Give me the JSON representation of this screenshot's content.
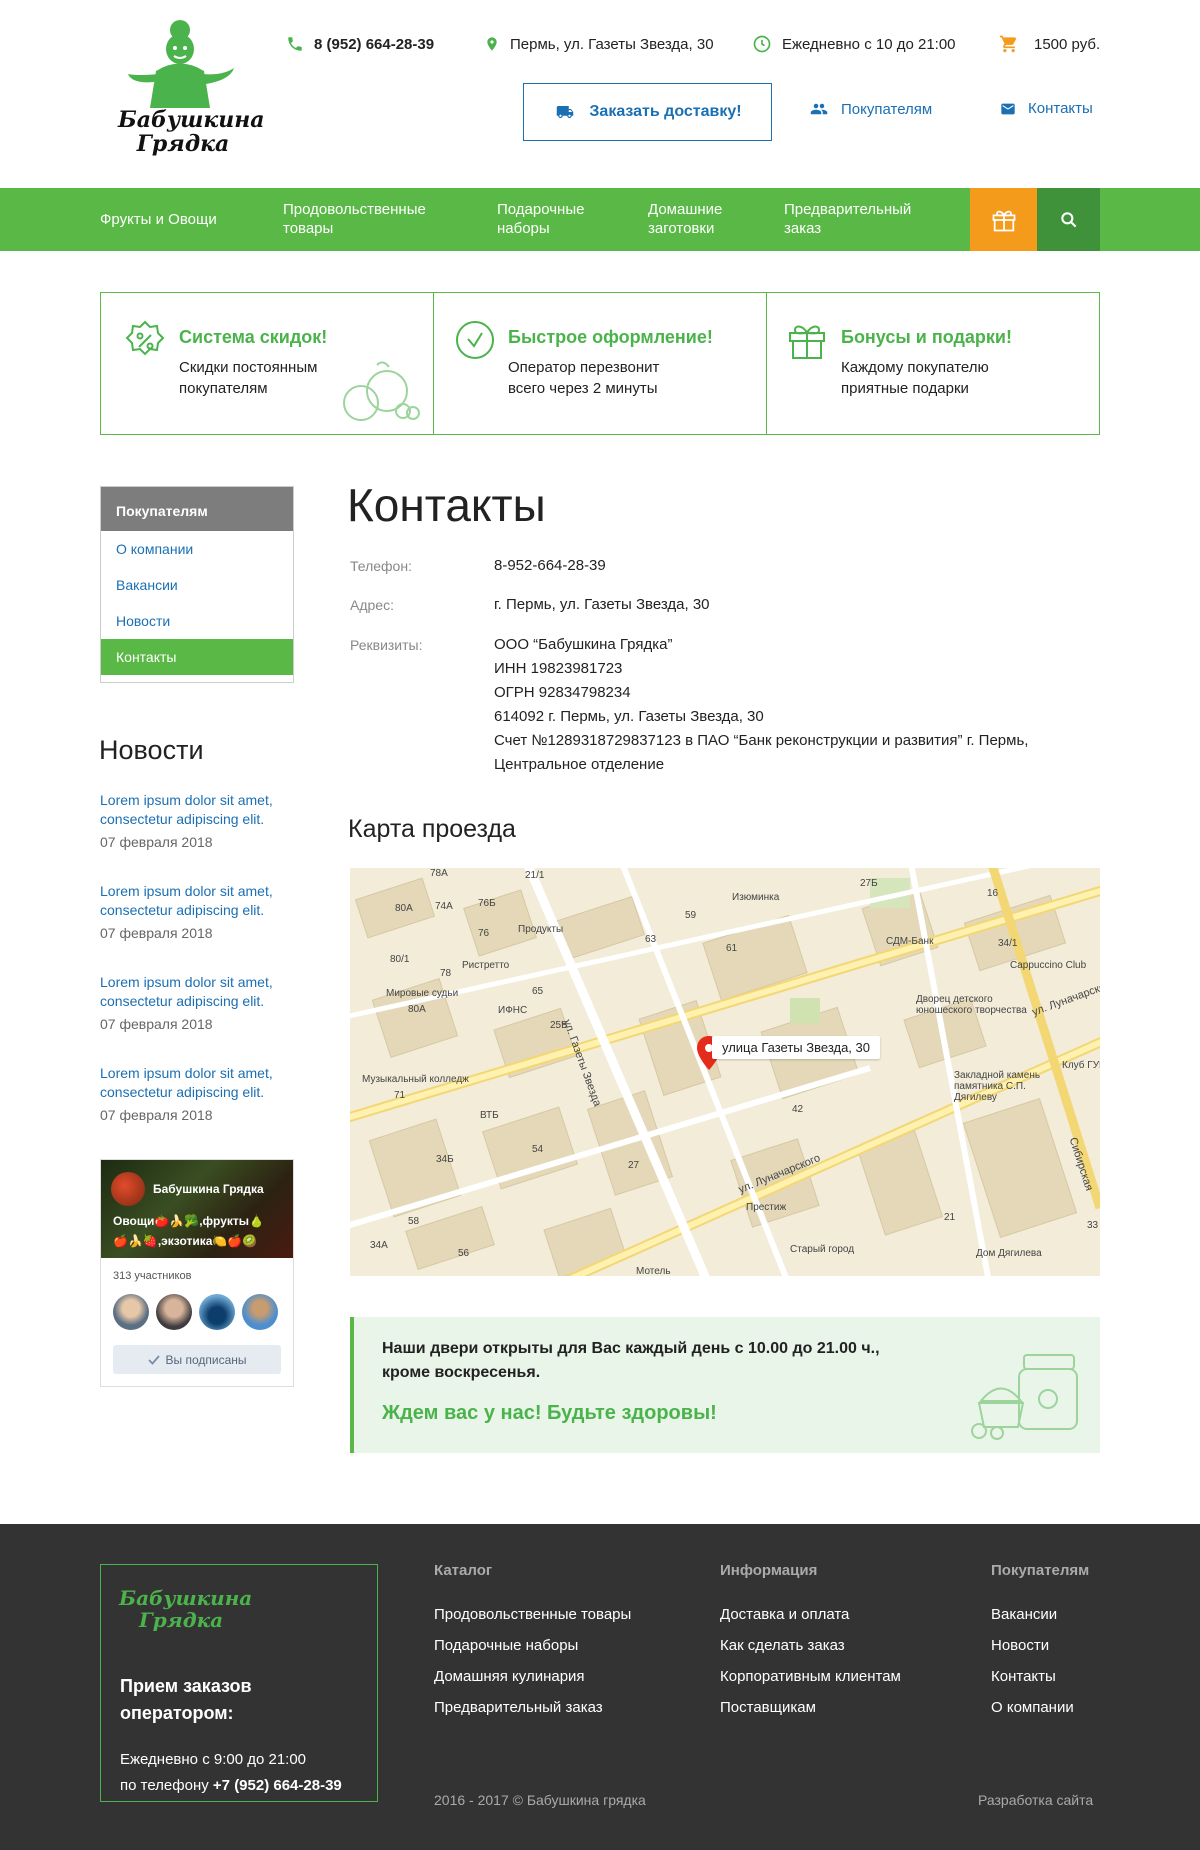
{
  "header": {
    "logo_text_line1": "Бабушкина",
    "logo_text_line2": "Грядка",
    "phone": "8 (952) 664-28-39",
    "address": "Пермь, ул. Газеты Звезда, 30",
    "hours": "Ежедневно с 10 до 21:00",
    "cart": "1500 руб.",
    "order_button": "Заказать доставку!",
    "link_customers": "Покупателям",
    "link_contacts": "Контакты"
  },
  "nav": {
    "items": [
      "Фрукты и Овощи",
      "Продовольственные\nтовары",
      "Подарочные\nнаборы",
      "Домашние\nзаготовки",
      "Предварительный\nзаказ"
    ]
  },
  "features": [
    {
      "title": "Система скидок!",
      "text": "Скидки постоянным\nпокупателям",
      "icon": "discount-badge-icon"
    },
    {
      "title": "Быстрое оформление!",
      "text": "Оператор перезвонит\nвсего через 2 минуты",
      "icon": "check-circle-icon"
    },
    {
      "title": "Бонусы и подарки!",
      "text": "Каждому покупателю\nприятные подарки",
      "icon": "gift-icon"
    }
  ],
  "sidebar": {
    "heading": "Покупателям",
    "items": [
      "О компании",
      "Вакансии",
      "Новости",
      "Контакты"
    ]
  },
  "news": {
    "title": "Новости",
    "items": [
      {
        "text": "Lorem ipsum dolor sit amet,\nconsectetur adipiscing elit.",
        "date": "07 февраля 2018"
      },
      {
        "text": "Lorem ipsum dolor sit amet,\nconsectetur adipiscing elit.",
        "date": "07 февраля 2018"
      },
      {
        "text": "Lorem ipsum dolor sit amet,\nconsectetur adipiscing elit.",
        "date": "07 февраля 2018"
      },
      {
        "text": "Lorem ipsum dolor sit amet,\nconsectetur adipiscing elit.",
        "date": "07 февраля 2018"
      }
    ]
  },
  "vk": {
    "name": "Бабушкина Грядка",
    "line1": "Овощи🍅🍌🥦,фрукты🍐",
    "line2": "🍎🍌🍓,экзотика🍋🍎🥝",
    "members": "313 участников",
    "button": "Вы подписаны"
  },
  "content": {
    "title": "Контакты",
    "phone_label": "Телефон:",
    "phone": "8-952-664-28-39",
    "address_label": "Адрес:",
    "address": "г. Пермь, ул. Газеты Звезда, 30",
    "requisites_label": "Реквизиты:",
    "requisites": [
      "ООО “Бабушкина Грядка”",
      "ИНН 19823981723",
      "ОГРН 92834798234",
      "614092 г. Пермь, ул. Газеты Звезда, 30",
      "Счет №1289318729837123 в ПАО “Банк реконструкции и развития” г. Пермь,",
      "Центральное отделение"
    ],
    "map_title": "Карта проезда",
    "map_pin": "улица Газеты Звезда, 30",
    "map_labels": [
      "78А",
      "21/1",
      "74А",
      "80А",
      "76Б",
      "76",
      "Продукты",
      "Изюминка",
      "59",
      "63",
      "27Б",
      "16",
      "61",
      "СДМ-Банк",
      "34/1",
      "Cappuccino Club",
      "80/1",
      "78",
      "Ристретто",
      "65",
      "Мировые судьи",
      "80А",
      "ИФНС",
      "25Б",
      "ул. Газеты Звезда",
      "Дворец детского юношеского творчества",
      "ул. Луначарского",
      "Музыкальный колледж",
      "71",
      "ВТБ",
      "Клуб ГУВД",
      "Закладной камень памятника С.П. Дягилеву",
      "42",
      "54",
      "34Б",
      "27",
      "ул. Луначарского",
      "Престиж",
      "58",
      "34А",
      "56",
      "Старый город",
      "21",
      "Дом Дягилева",
      "33",
      "Сибирская",
      "Мотель"
    ],
    "notice_text": "Наши двери открыты для Вас каждый день с 10.00 до 21.00 ч.,\nкроме воскресенья.",
    "notice_cta": "Ждем вас у нас! Будьте здоровы!"
  },
  "footer": {
    "logo_line1": "Бабушкина",
    "logo_line2": "Грядка",
    "orders_heading": "Прием заказов\nоператором:",
    "hours": "Ежедневно с 9:00 до 21:00",
    "phone_prefix": "по телефону",
    "phone": "+7 (952) 664-28-39",
    "catalog_heading": "Каталог",
    "catalog_items": [
      "Продовольственные товары",
      "Подарочные наборы",
      "Домашняя кулинария",
      "Предварительный заказ"
    ],
    "info_heading": "Информация",
    "info_items": [
      "Доставка и оплата",
      "Как сделать заказ",
      "Корпоративным клиентам",
      "Поставщикам"
    ],
    "customers_heading": "Покупателям",
    "customers_items": [
      "Вакансии",
      "Новости",
      "Контакты",
      "О компании"
    ],
    "copyright": "2016 - 2017 © Бабушкина грядка",
    "developer": "Разработка сайта"
  },
  "colors": {
    "green": "#5ab946",
    "dark_green": "#3f913a",
    "orange": "#f49b1c",
    "blue": "#1b6fb3",
    "footer_bg": "#333333"
  }
}
